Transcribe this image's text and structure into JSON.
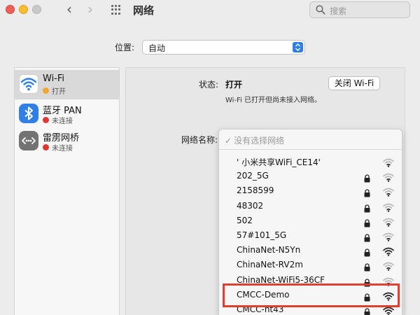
{
  "window": {
    "title": "网络"
  },
  "search": {
    "placeholder": "搜索"
  },
  "location": {
    "label": "位置:",
    "value": "自动"
  },
  "sidebar": {
    "items": [
      {
        "name": "Wi-Fi",
        "status": "打开",
        "status_color": "#f1a632",
        "icon": "wifi-icon",
        "selected": true
      },
      {
        "name": "蓝牙 PAN",
        "status": "未连接",
        "status_color": "#e0362f",
        "icon": "bluetooth-icon"
      },
      {
        "name": "雷雳网桥",
        "status": "未连接",
        "status_color": "#e0362f",
        "icon": "thunderbolt-bridge-icon"
      }
    ]
  },
  "main": {
    "status_label": "状态:",
    "status_value": "打开",
    "status_description": "Wi-Fi 已打开但尚未接入网络。",
    "turn_off_button": "关闭 Wi-Fi",
    "network_name_label": "网络名称:"
  },
  "dropdown": {
    "header_check": "✓",
    "header": "没有选择网络",
    "networks": [
      {
        "name": "' 小米共享WiFi_CE14'",
        "locked": false,
        "signal": "weak"
      },
      {
        "name": "202_5G",
        "locked": true,
        "signal": "weak"
      },
      {
        "name": "2158599",
        "locked": true,
        "signal": "weak"
      },
      {
        "name": "48302",
        "locked": true,
        "signal": "weak"
      },
      {
        "name": "502",
        "locked": true,
        "signal": "weak"
      },
      {
        "name": "57#101_5G",
        "locked": true,
        "signal": "weak"
      },
      {
        "name": "ChinaNet-N5Yn",
        "locked": true,
        "signal": "strong"
      },
      {
        "name": "ChinaNet-RV2m",
        "locked": true,
        "signal": "weak"
      },
      {
        "name": "ChinaNet-WiFi5-36CF",
        "locked": true,
        "signal": "weak"
      },
      {
        "name": "CMCC-Demo",
        "locked": true,
        "signal": "strong",
        "highlighted": true
      },
      {
        "name": "CMCC-ht43",
        "locked": true,
        "signal": "strong"
      }
    ]
  },
  "colors": {
    "accent": "#2f7fe6",
    "highlight_border": "#e0402f"
  }
}
